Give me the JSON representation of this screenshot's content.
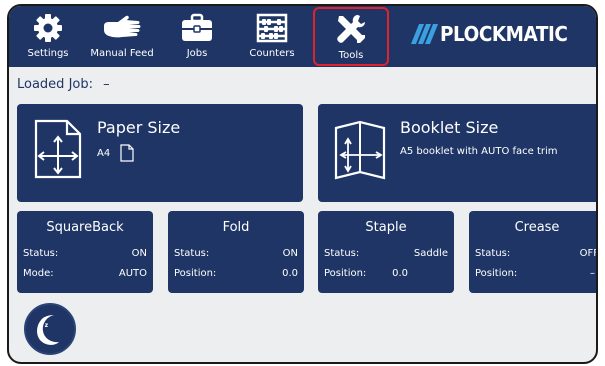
{
  "nav": {
    "items": [
      {
        "label": "Settings",
        "icon": "gear-icon"
      },
      {
        "label": "Manual Feed",
        "icon": "hand-icon"
      },
      {
        "label": "Jobs",
        "icon": "briefcase-icon"
      },
      {
        "label": "Counters",
        "icon": "abacus-icon"
      },
      {
        "label": "Tools",
        "icon": "wrench-screwdriver-icon",
        "active": true
      }
    ]
  },
  "logo": {
    "text": "PLOCKMATIC",
    "slash_color": "#3aa0e0"
  },
  "loaded_job": {
    "label": "Loaded Job:",
    "value": "–"
  },
  "paper_size": {
    "title": "Paper Size",
    "value": "A4"
  },
  "booklet_size": {
    "title": "Booklet Size",
    "value": "A5 booklet with AUTO face trim"
  },
  "squareback": {
    "title": "SquareBack",
    "status_label": "Status:",
    "status": "ON",
    "mode_label": "Mode:",
    "mode": "AUTO"
  },
  "fold": {
    "title": "Fold",
    "status_label": "Status:",
    "status": "ON",
    "position_label": "Position:",
    "position": "0.0"
  },
  "staple": {
    "title": "Staple",
    "status_label": "Status:",
    "status": "Saddle",
    "position_label": "Position:",
    "position": "0.0"
  },
  "crease": {
    "title": "Crease",
    "status_label": "Status:",
    "status": "OFF",
    "position_label": "Position:",
    "position": "–"
  },
  "sleep": {
    "icon": "sleep-moon-icon",
    "glyph": "z z"
  },
  "colors": {
    "primary": "#1e3566",
    "background": "#edeef0",
    "active_outline": "#e0242b"
  }
}
